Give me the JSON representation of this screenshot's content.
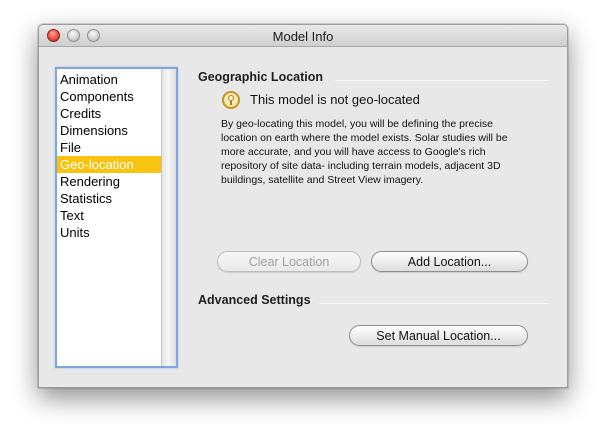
{
  "window": {
    "title": "Model Info",
    "controls": {
      "close": "close-button",
      "minimize": "minimize-button",
      "zoom": "zoom-button"
    }
  },
  "sidebar": {
    "items": [
      {
        "label": "Animation",
        "selected": false
      },
      {
        "label": "Components",
        "selected": false
      },
      {
        "label": "Credits",
        "selected": false
      },
      {
        "label": "Dimensions",
        "selected": false
      },
      {
        "label": "File",
        "selected": false
      },
      {
        "label": "Geo-location",
        "selected": true
      },
      {
        "label": "Rendering",
        "selected": false
      },
      {
        "label": "Statistics",
        "selected": false
      },
      {
        "label": "Text",
        "selected": false
      },
      {
        "label": "Units",
        "selected": false
      }
    ]
  },
  "geographic": {
    "heading": "Geographic Location",
    "status_icon": "lightbulb-icon",
    "status_text": "This model is not geo-located",
    "description": "By geo-locating this model, you will be defining the precise location on earth where the model exists. Solar studies will be more accurate, and you will have access to Google's rich repository of site data- including terrain models, adjacent 3D buildings, satellite and Street View imagery.",
    "clear_button": "Clear Location",
    "add_button": "Add Location..."
  },
  "advanced": {
    "heading": "Advanced Settings",
    "manual_button": "Set Manual Location..."
  },
  "colors": {
    "selection": "#f9c410",
    "focus_ring": "#7fa6d6",
    "window_bg": "#e8e8e8"
  }
}
